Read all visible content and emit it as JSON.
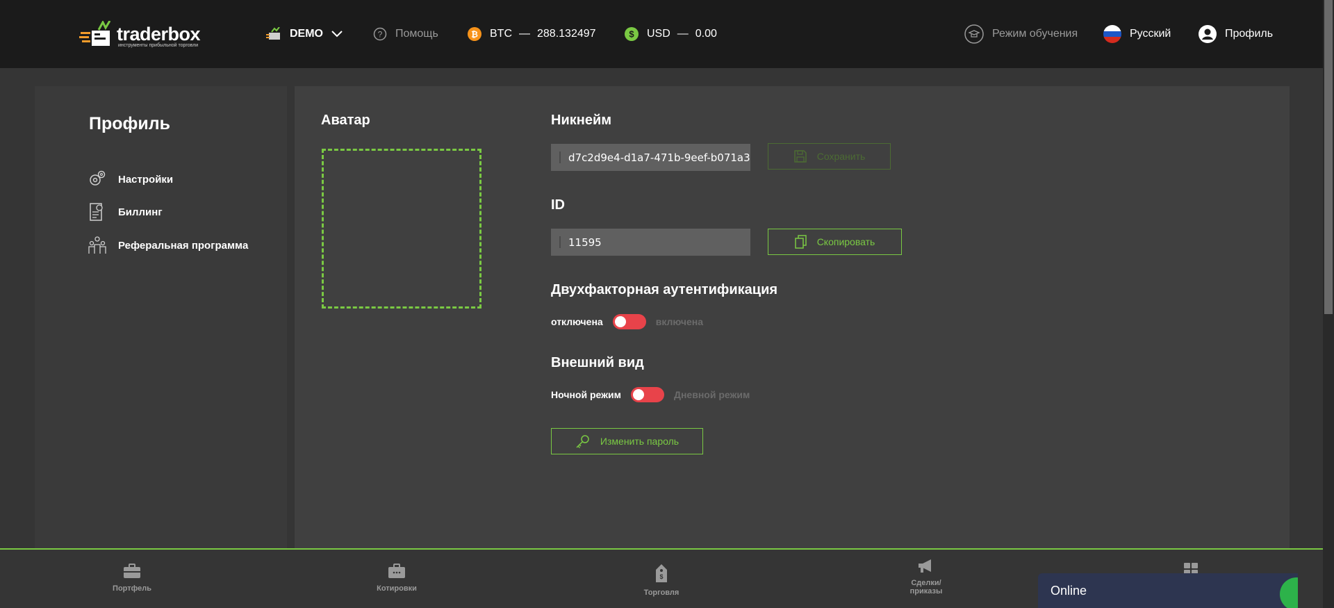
{
  "header": {
    "logo_text": "traderbox",
    "logo_sub": "инструменты прибыльной торговли",
    "account": "DEMO",
    "help": "Помощь",
    "btc_label": "BTC",
    "btc_dash": "—",
    "btc_value": "288.132497",
    "usd_label": "USD",
    "usd_dash": "—",
    "usd_value": "0.00",
    "training": "Режим обучения",
    "language": "Русский",
    "profile": "Профиль"
  },
  "sidebar": {
    "title": "Профиль",
    "items": [
      {
        "label": "Настройки",
        "icon": "gears-icon"
      },
      {
        "label": "Биллинг",
        "icon": "billing-icon"
      },
      {
        "label": "Реферальная программа",
        "icon": "people-icon"
      }
    ]
  },
  "main": {
    "avatar_title": "Аватар",
    "nickname_title": "Никнейм",
    "nickname_value": "d7c2d9e4-d1a7-471b-9eef-b071a3",
    "save_label": "Сохранить",
    "id_title": "ID",
    "id_value": "11595",
    "copy_label": "Скопировать",
    "twofa_title": "Двухфакторная аутентификация",
    "twofa_off": "отключена",
    "twofa_on": "включена",
    "appearance_title": "Внешний вид",
    "night_mode": "Ночной режим",
    "day_mode": "Дневной режим",
    "change_password": "Изменить пароль"
  },
  "bottom_nav": {
    "portfolio": "Портфель",
    "quotes": "Котировки",
    "trading": "Торговля",
    "deals_line1": "Сделки/",
    "deals_line2": "приказы"
  },
  "chat": {
    "status": "Online"
  },
  "colors": {
    "accent": "#7ac943",
    "header_bg": "#1b1b1b",
    "toggle_off": "#e8434a",
    "btc": "#f7931a",
    "usd": "#7ac943"
  }
}
